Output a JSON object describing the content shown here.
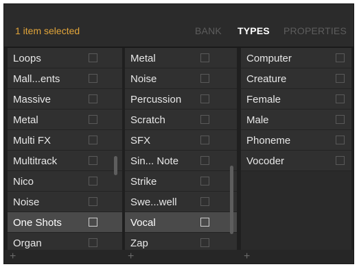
{
  "header": {
    "status": "1 item selected",
    "tabs": [
      "BANK",
      "TYPES",
      "PROPERTIES"
    ],
    "active_tab": "TYPES"
  },
  "colors": {
    "status": "#e2a53a",
    "panel": "#2b2b2b",
    "row": "#303030",
    "row_selected": "#4a4a4a",
    "tab_inactive": "#5d5d5d",
    "tab_active": "#ffffff"
  },
  "columns": [
    {
      "items": [
        {
          "label": "Loops"
        },
        {
          "label": "Mall...ents"
        },
        {
          "label": "Massive"
        },
        {
          "label": "Metal"
        },
        {
          "label": "Multi FX"
        },
        {
          "label": "Multitrack"
        },
        {
          "label": "Nico"
        },
        {
          "label": "Noise"
        },
        {
          "label": "One Shots"
        },
        {
          "label": "Organ"
        }
      ],
      "footer": "+"
    },
    {
      "items": [
        {
          "label": "Metal"
        },
        {
          "label": "Noise"
        },
        {
          "label": "Percussion"
        },
        {
          "label": "Scratch"
        },
        {
          "label": "SFX"
        },
        {
          "label": "Sin... Note"
        },
        {
          "label": "Strike"
        },
        {
          "label": "Swe...well"
        },
        {
          "label": "Vocal"
        },
        {
          "label": "Zap"
        }
      ],
      "footer": "+"
    },
    {
      "items": [
        {
          "label": "Computer"
        },
        {
          "label": "Creature"
        },
        {
          "label": "Female"
        },
        {
          "label": "Male"
        },
        {
          "label": "Phoneme"
        },
        {
          "label": "Vocoder"
        }
      ],
      "footer": "+"
    }
  ]
}
